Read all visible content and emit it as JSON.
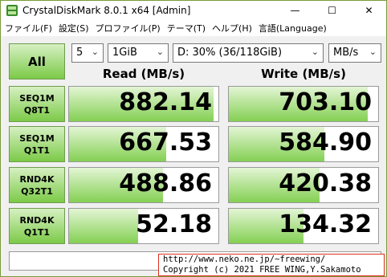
{
  "window": {
    "title": "CrystalDiskMark 8.0.1 x64 [Admin]",
    "controls": {
      "minimize": "—",
      "maximize": "☐",
      "close": "✕"
    }
  },
  "menu": {
    "items": [
      "ファイル(F)",
      "設定(S)",
      "プロファイル(P)",
      "テーマ(T)",
      "ヘルプ(H)",
      "言語(Language)"
    ]
  },
  "toolbar": {
    "all_label": "All",
    "count": "5",
    "size": "1GiB",
    "drive": "D: 30% (36/118GiB)",
    "unit": "MB/s"
  },
  "headers": {
    "read": "Read (MB/s)",
    "write": "Write (MB/s)"
  },
  "tests": [
    {
      "line1": "SEQ1M",
      "line2": "Q8T1",
      "read": "882.14",
      "write": "703.10",
      "read_fill": 0.97,
      "write_fill": 0.93
    },
    {
      "line1": "SEQ1M",
      "line2": "Q1T1",
      "read": "667.53",
      "write": "584.90",
      "read_fill": 0.65,
      "write_fill": 0.64
    },
    {
      "line1": "RND4K",
      "line2": "Q32T1",
      "read": "488.86",
      "write": "420.38",
      "read_fill": 0.63,
      "write_fill": 0.61
    },
    {
      "line1": "RND4K",
      "line2": "Q1T1",
      "read": "52.18",
      "write": "134.32",
      "read_fill": 0.46,
      "write_fill": 0.5
    }
  ],
  "status": "",
  "footer": {
    "line1": "http://www.neko.ne.jp/~freewing/",
    "line2": "Copyright (c) 2021 FREE WING,Y.Sakamoto"
  },
  "colors": {
    "accent": "#84d053",
    "border": "#6f9c4d"
  }
}
